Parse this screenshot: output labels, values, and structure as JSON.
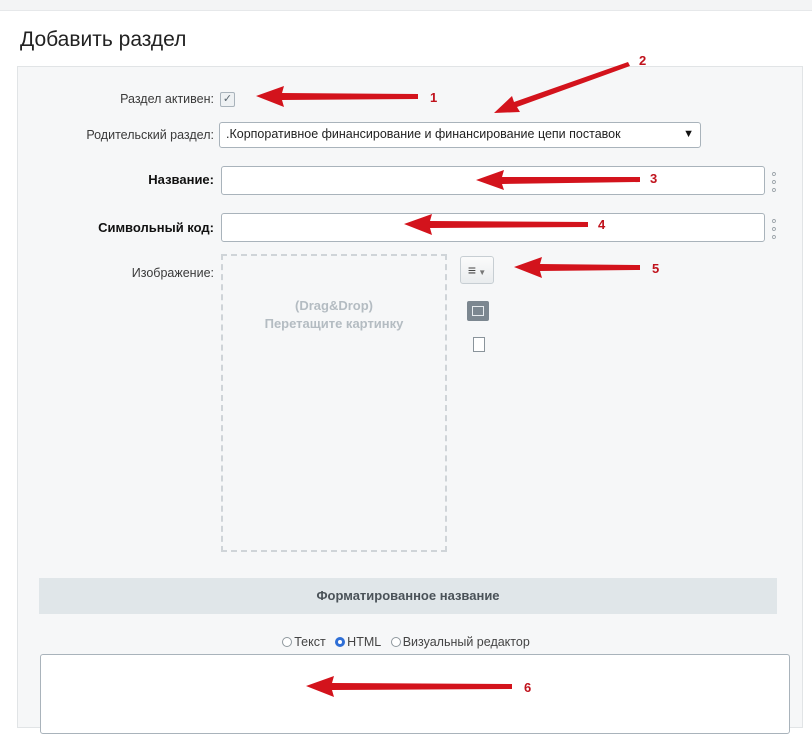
{
  "page": {
    "title": "Добавить раздел"
  },
  "form": {
    "active": {
      "label": "Раздел активен:",
      "checked": true
    },
    "parent": {
      "label": "Родительский раздел:",
      "value": ".Корпоративное финансирование и финансирование цепи поставок"
    },
    "name": {
      "label": "Название:",
      "value": ""
    },
    "code": {
      "label": "Символьный код:",
      "value": ""
    },
    "image": {
      "label": "Изображение:",
      "dropzone_title": "(Drag&Drop)",
      "dropzone_text": "Перетащите картинку"
    }
  },
  "formatted_name": {
    "header": "Форматированное название",
    "modes": [
      {
        "label": "Текст",
        "selected": false
      },
      {
        "label": "HTML",
        "selected": true
      },
      {
        "label": "Визуальный редактор",
        "selected": false
      }
    ],
    "value": ""
  },
  "annotations": {
    "color": "#c0121c",
    "numbers": [
      "1",
      "2",
      "3",
      "4",
      "5",
      "6"
    ]
  }
}
